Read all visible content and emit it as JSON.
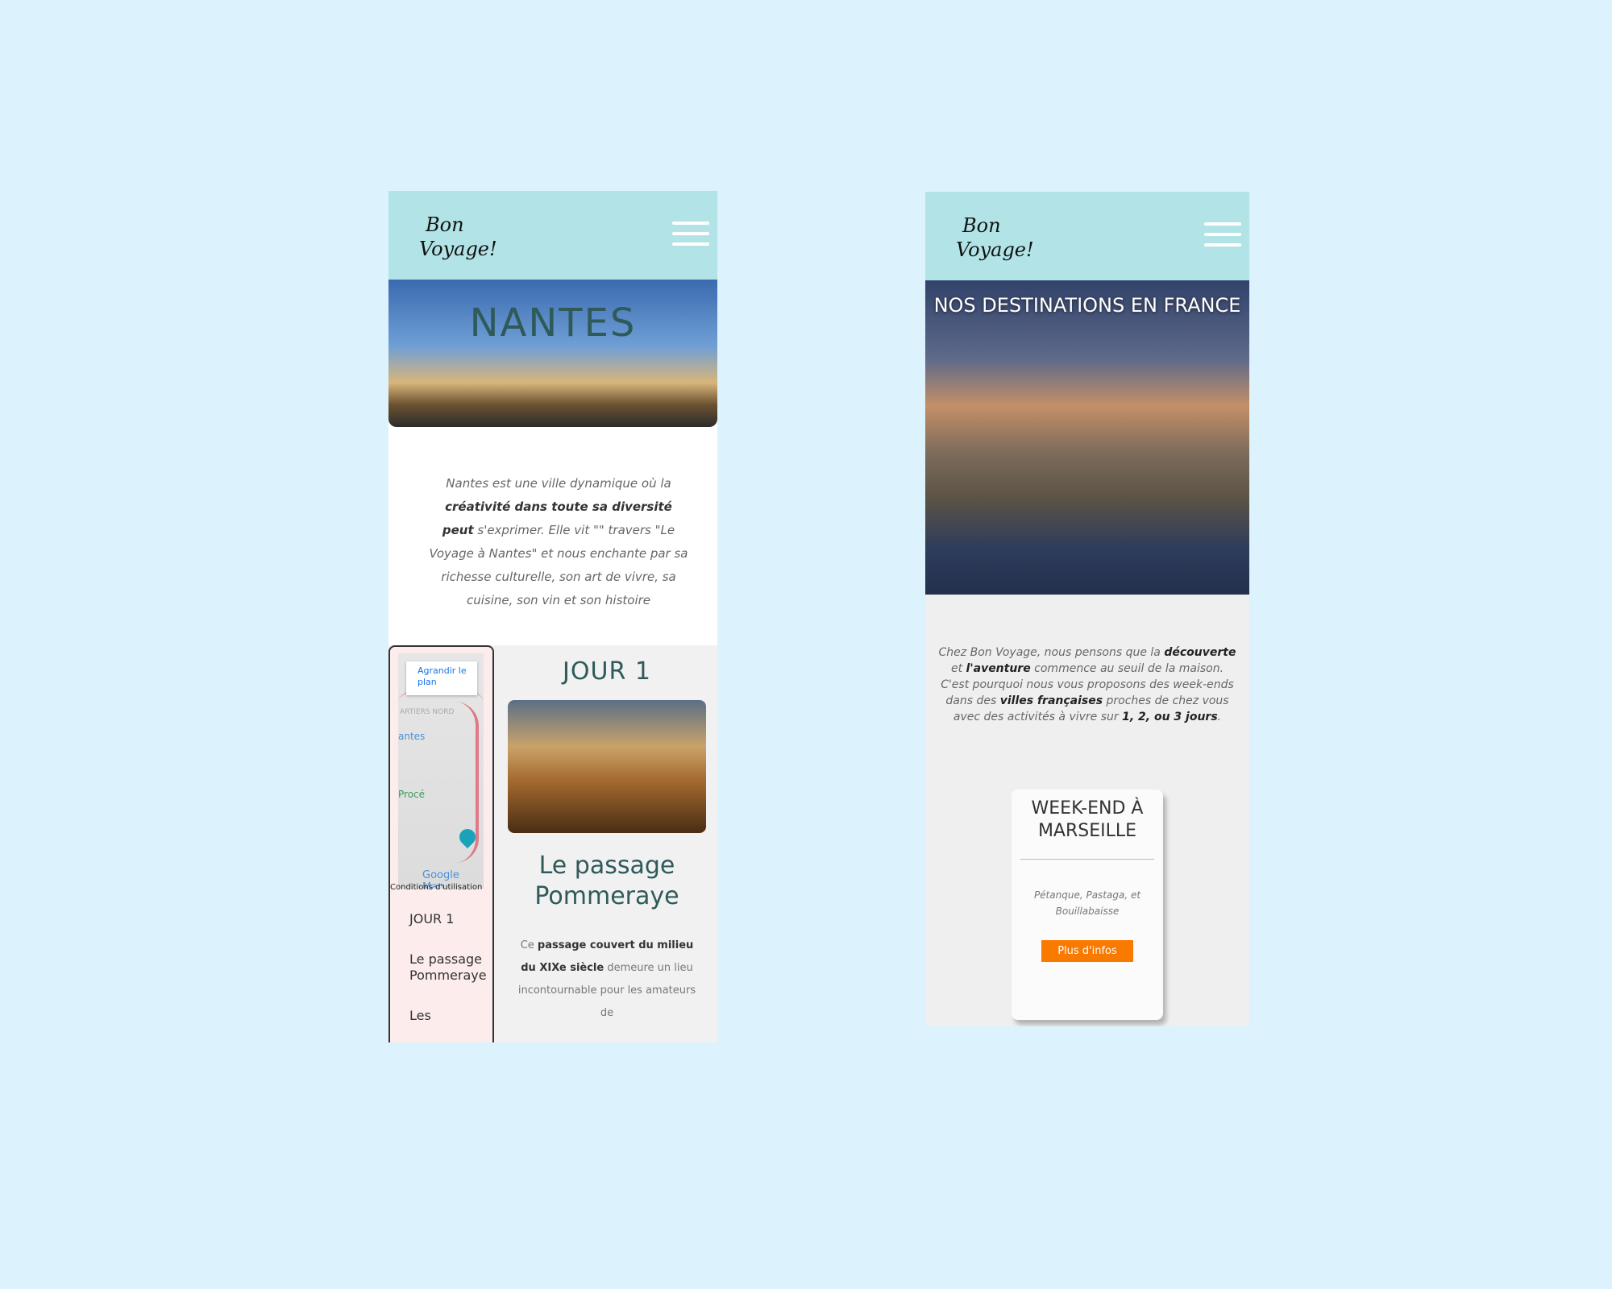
{
  "nantes_page": {
    "logo_alt": "Bon Voyage!",
    "hero_title": "NANTES",
    "intro": {
      "part1": "Nantes est une ville dynamique où la ",
      "bold": "créativité dans toute sa diversité peut",
      "part2": " s'exprimer. Elle vit \"\" travers \"Le Voyage à Nantes\" et nous enchante par sa richesse culturelle, son art de vivre, sa cuisine, son vin et son histoire"
    },
    "map": {
      "enlarge_label": "Agrandir le plan",
      "town_label": "antes",
      "area_label": "ARTIERS NORD",
      "town2_label": "Procé",
      "google_label": "Google Map",
      "terms_label": "Conditions d'utilisation"
    },
    "side_nav": [
      "JOUR 1",
      "Le passage Pommeraye",
      "Les"
    ],
    "day": {
      "title": "JOUR 1",
      "subtitle": "Le passage Pommeraye",
      "text_part1": "Ce ",
      "text_bold": "passage couvert du milieu du XIXe siècle",
      "text_part2": " demeure un lieu incontournable pour les amateurs de"
    }
  },
  "home_page": {
    "logo_alt": "Bon Voyage!",
    "hero_title": "NOS DESTINATIONS EN FRANCE",
    "intro": {
      "p1_a": "Chez Bon Voyage, nous pensons que la ",
      "p1_b": "découverte",
      "p1_c": " et ",
      "p1_d": "l'aventure",
      "p1_e": " commence au seuil de la maison.",
      "p2_a": "C'est pourquoi nous vous proposons des week-ends dans des ",
      "p2_b": "villes françaises",
      "p2_c": " proches de chez vous avec des activités à vivre sur ",
      "p2_d": "1, 2, ou 3 jours",
      "p2_e": "."
    },
    "card": {
      "title": "WEEK-END À MARSEILLE",
      "text": "Pétanque, Pastaga, et Bouillabaisse",
      "button": "Plus d'infos"
    }
  },
  "colors": {
    "header": "#b2e4e7",
    "accent": "#f97a00",
    "title": "#2f5a5a",
    "background": "#dcf2fd"
  }
}
